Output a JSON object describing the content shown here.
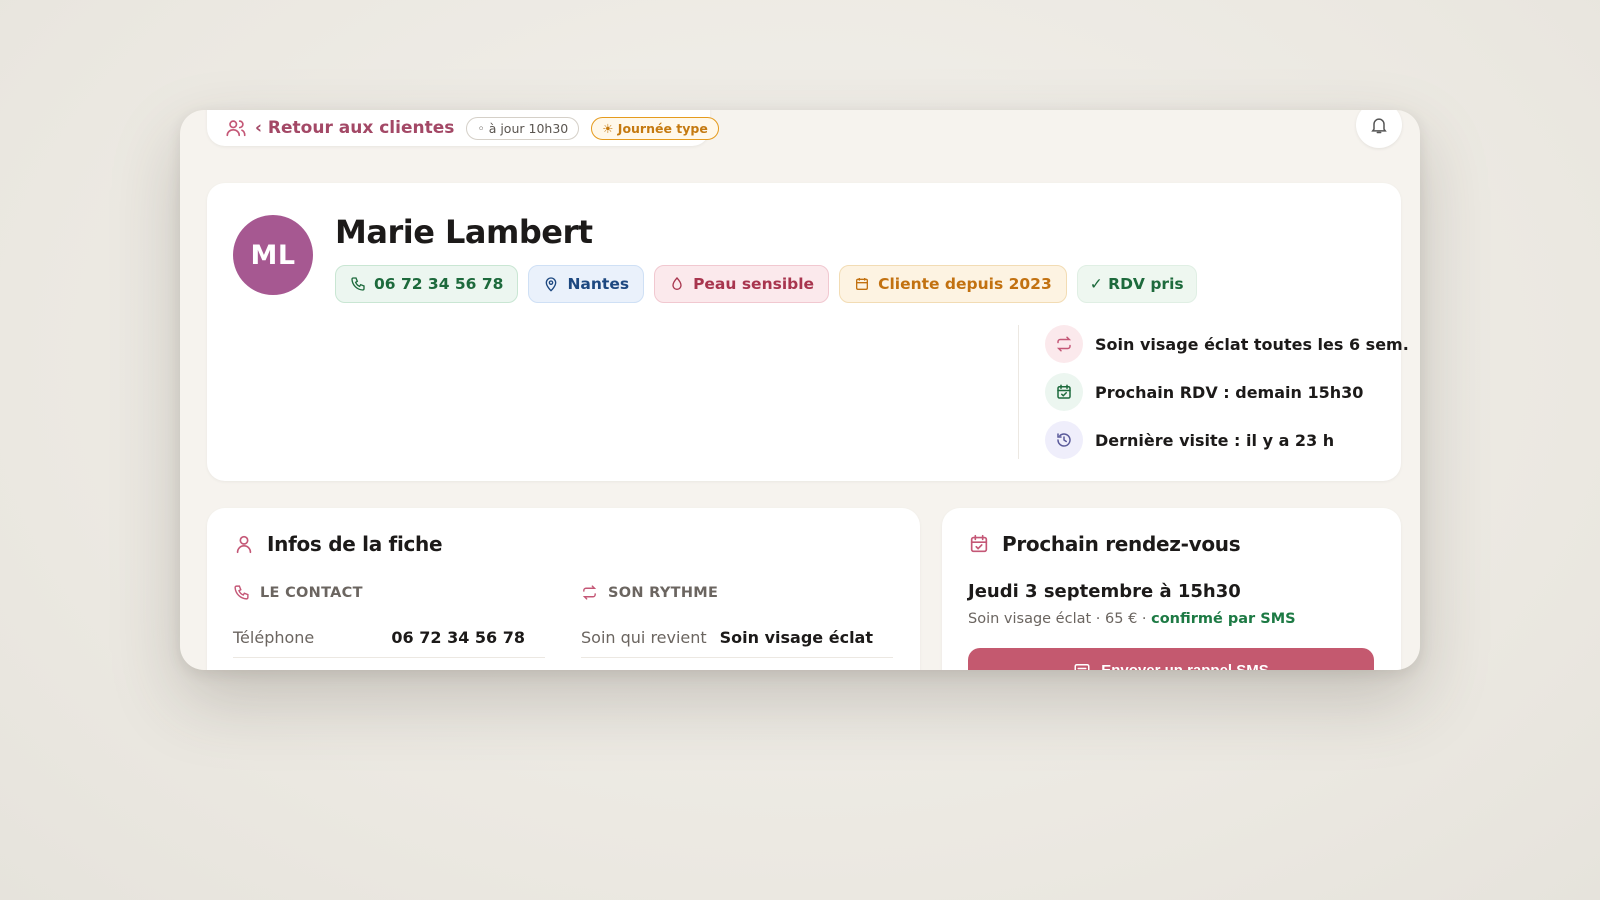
{
  "topbar": {
    "back_label": "‹ Retour aux clientes",
    "sync_label": "◦ à jour 10h30",
    "day_label": "☀ Journée type"
  },
  "client": {
    "initials": "ML",
    "name": "Marie Lambert",
    "chips": {
      "phone": "06 72 34 56 78",
      "city": "Nantes",
      "skin": "Peau sensible",
      "since": "Cliente depuis 2023",
      "rdv": "✓ RDV pris"
    },
    "facts": {
      "recurring": "Soin visage éclat toutes les 6 sem.",
      "next": "Prochain RDV : demain 15h30",
      "last": "Dernière visite : il y a 23 h"
    }
  },
  "infos": {
    "title": "Infos de la fiche",
    "contact_head": "LE CONTACT",
    "rhythm_head": "SON RYTHME",
    "phone_key": "Téléphone",
    "phone_val": "06 72 34 56 78",
    "care_key": "Soin qui revient",
    "care_val": "Soin visage éclat"
  },
  "rdv": {
    "title": "Prochain rendez-vous",
    "date": "Jeudi 3 septembre à 15h30",
    "details": "Soin visage éclat · 65 € · ",
    "confirmed": "confirmé par SMS",
    "button": "Envoyer un rappel SMS"
  },
  "colors": {
    "accent": "#c45776",
    "avatar": "#a65891",
    "button": "#c4596f"
  }
}
